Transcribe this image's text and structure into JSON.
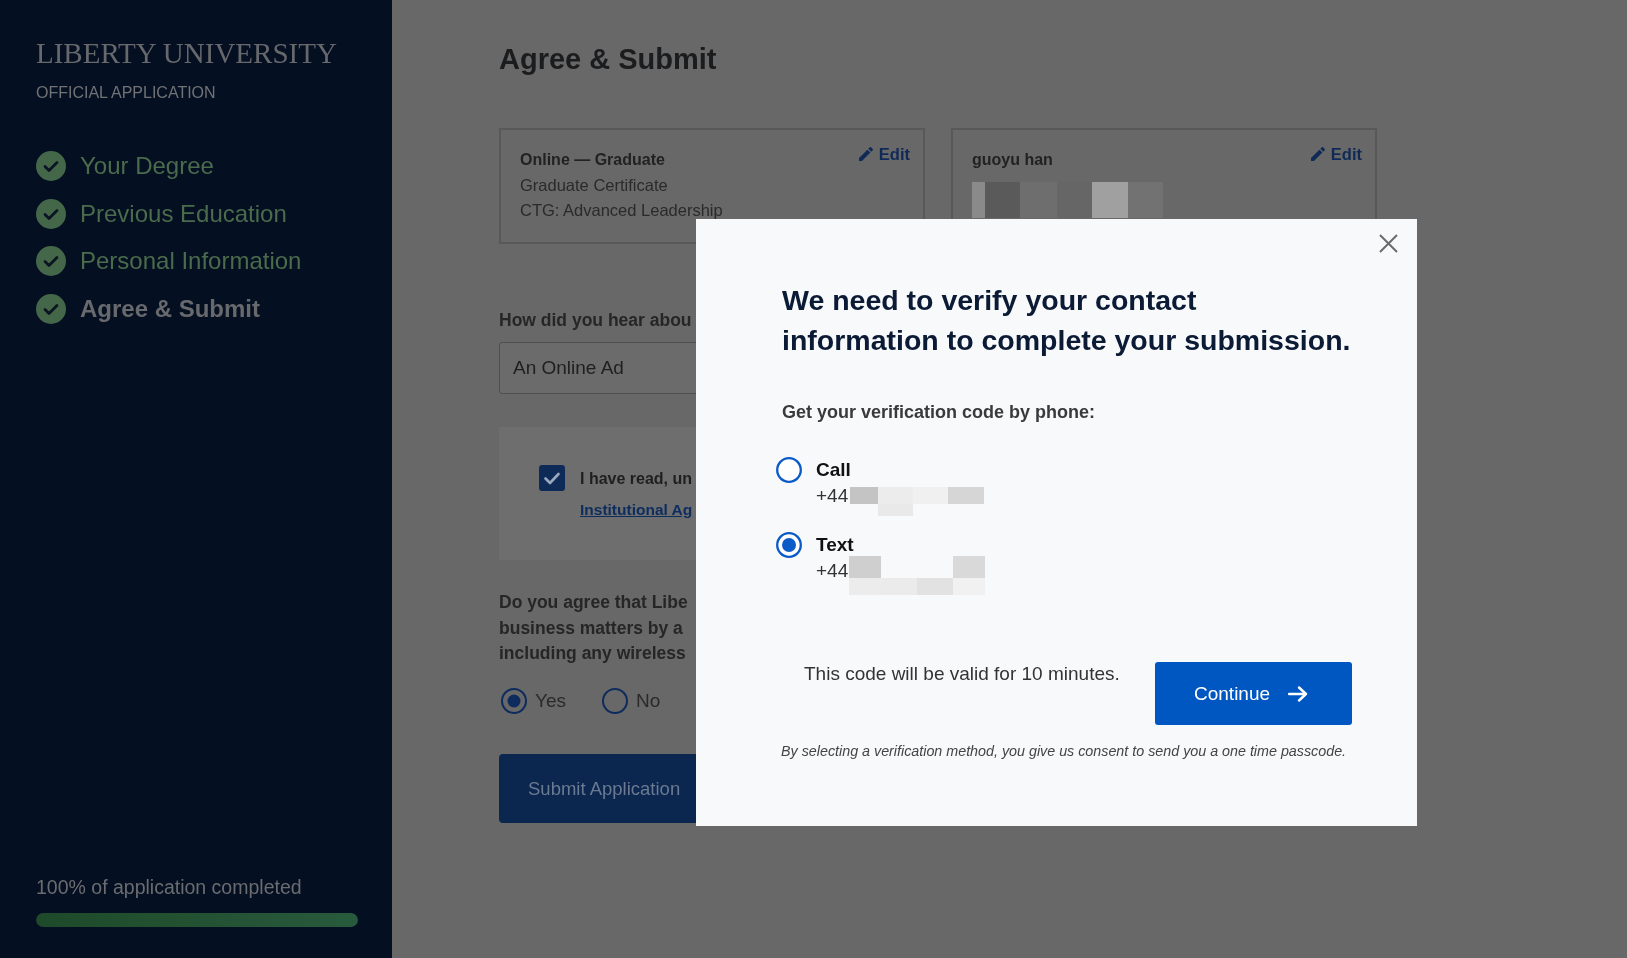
{
  "sidebar": {
    "logo": "LIBERTY UNIVERSITY",
    "subtitle": "OFFICIAL APPLICATION",
    "steps": [
      {
        "label": "Your Degree",
        "completed": true,
        "selected": false
      },
      {
        "label": "Previous Education",
        "completed": true,
        "selected": false
      },
      {
        "label": "Personal Information",
        "completed": true,
        "selected": false
      },
      {
        "label": "Agree & Submit",
        "completed": true,
        "selected": true
      }
    ],
    "progress": {
      "text": "100% of application completed",
      "level": 1
    }
  },
  "main": {
    "title": "Agree & Submit",
    "summary_cards": [
      {
        "kind": "program",
        "title": "Online — Graduate",
        "lines": [
          "Graduate Certificate",
          "CTG: Advanced Leadership"
        ],
        "edit_label": "Edit"
      },
      {
        "kind": "contact",
        "title": "guoyu han",
        "edit_label": "Edit"
      }
    ],
    "referral": {
      "label": "How did you hear abou",
      "value": "An Online Ad"
    },
    "agreement": {
      "checked": true,
      "text": "I have read, un",
      "link": "Institutional Ag"
    },
    "contact_consent": {
      "question_lines": [
        "Do you agree that Libe",
        "business matters by a",
        "including any wireless"
      ],
      "options": [
        {
          "label": "Yes",
          "selected": true
        },
        {
          "label": "No",
          "selected": false
        }
      ]
    },
    "submit_button": "Submit Application"
  },
  "verification_dialog": {
    "title": "We need to verify your contact information to complete your submission.",
    "prompt": "Get your verification code by phone:",
    "options": [
      {
        "label": "Call",
        "number": "+44",
        "selected": false
      },
      {
        "label": "Text",
        "number": "+44",
        "selected": true
      }
    ],
    "validity_note": "This code will be valid for 10 minutes.",
    "continue_button": "Continue",
    "consent_note": "By selecting a verification method, you give us consent to send you a one time passcode."
  }
}
